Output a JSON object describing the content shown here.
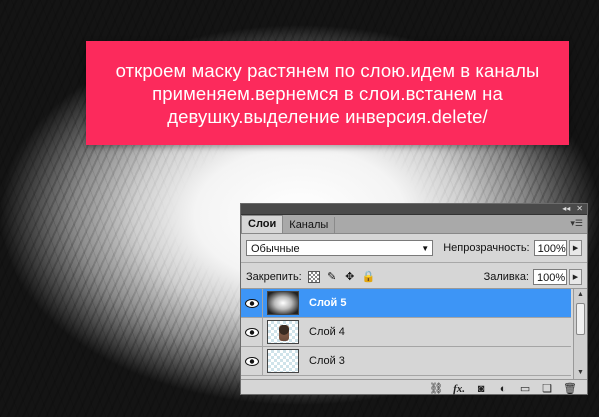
{
  "banner": {
    "line1": "откроем маску растянем по слою.идем в каналы",
    "line2": "применяем.вернемся в слои.встанем на",
    "line3": "девушку.выделение инверсия.delete/"
  },
  "panel": {
    "tabs": [
      {
        "label": "Слои",
        "active": true
      },
      {
        "label": "Каналы",
        "active": false
      }
    ],
    "blend_mode": "Обычные",
    "opacity_label": "Непрозрачность:",
    "opacity_value": "100%",
    "lock_label": "Закрепить:",
    "fill_label": "Заливка:",
    "fill_value": "100%",
    "layers": [
      {
        "name": "Слой 5",
        "selected": true,
        "visible": true,
        "thumb": "mask"
      },
      {
        "name": "Слой 4",
        "selected": false,
        "visible": true,
        "thumb": "girl"
      },
      {
        "name": "Слой 3",
        "selected": false,
        "visible": true,
        "thumb": "transparent"
      }
    ],
    "toolbar_icons": [
      "link-icon",
      "fx-icon",
      "add-mask-icon",
      "adjustment-icon",
      "folder-icon",
      "new-layer-icon",
      "trash-icon"
    ],
    "toolbar_fx_label": "fx."
  },
  "colors": {
    "banner": "#fc2a5c",
    "selected_layer": "#3d95f6"
  }
}
